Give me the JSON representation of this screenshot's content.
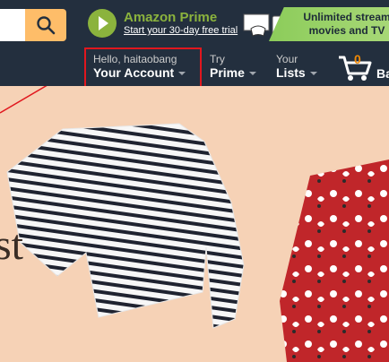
{
  "search": {
    "placeholder": ""
  },
  "promo": {
    "prime_title": "Amazon Prime",
    "prime_subtitle": "Start your 30-day free trial",
    "streaming_line1": "Unlimited stream",
    "streaming_line2": "movies and TV"
  },
  "nav": {
    "account_greeting": "Hello, haitaobang",
    "account_label": "Your Account",
    "try_label": "Try",
    "prime_label": "Prime",
    "lists_top": "Your",
    "lists_label": "Lists",
    "cart_count": "0",
    "cart_label": "Ba"
  },
  "hero": {
    "text_fragment": "st"
  },
  "colors": {
    "nav_bg": "#232f3e",
    "search_button": "#febd69",
    "prime_green": "#8bb33d",
    "highlight": "#e1171e",
    "cart_count": "#f08804",
    "hero_bg": "#f6d2b6"
  }
}
